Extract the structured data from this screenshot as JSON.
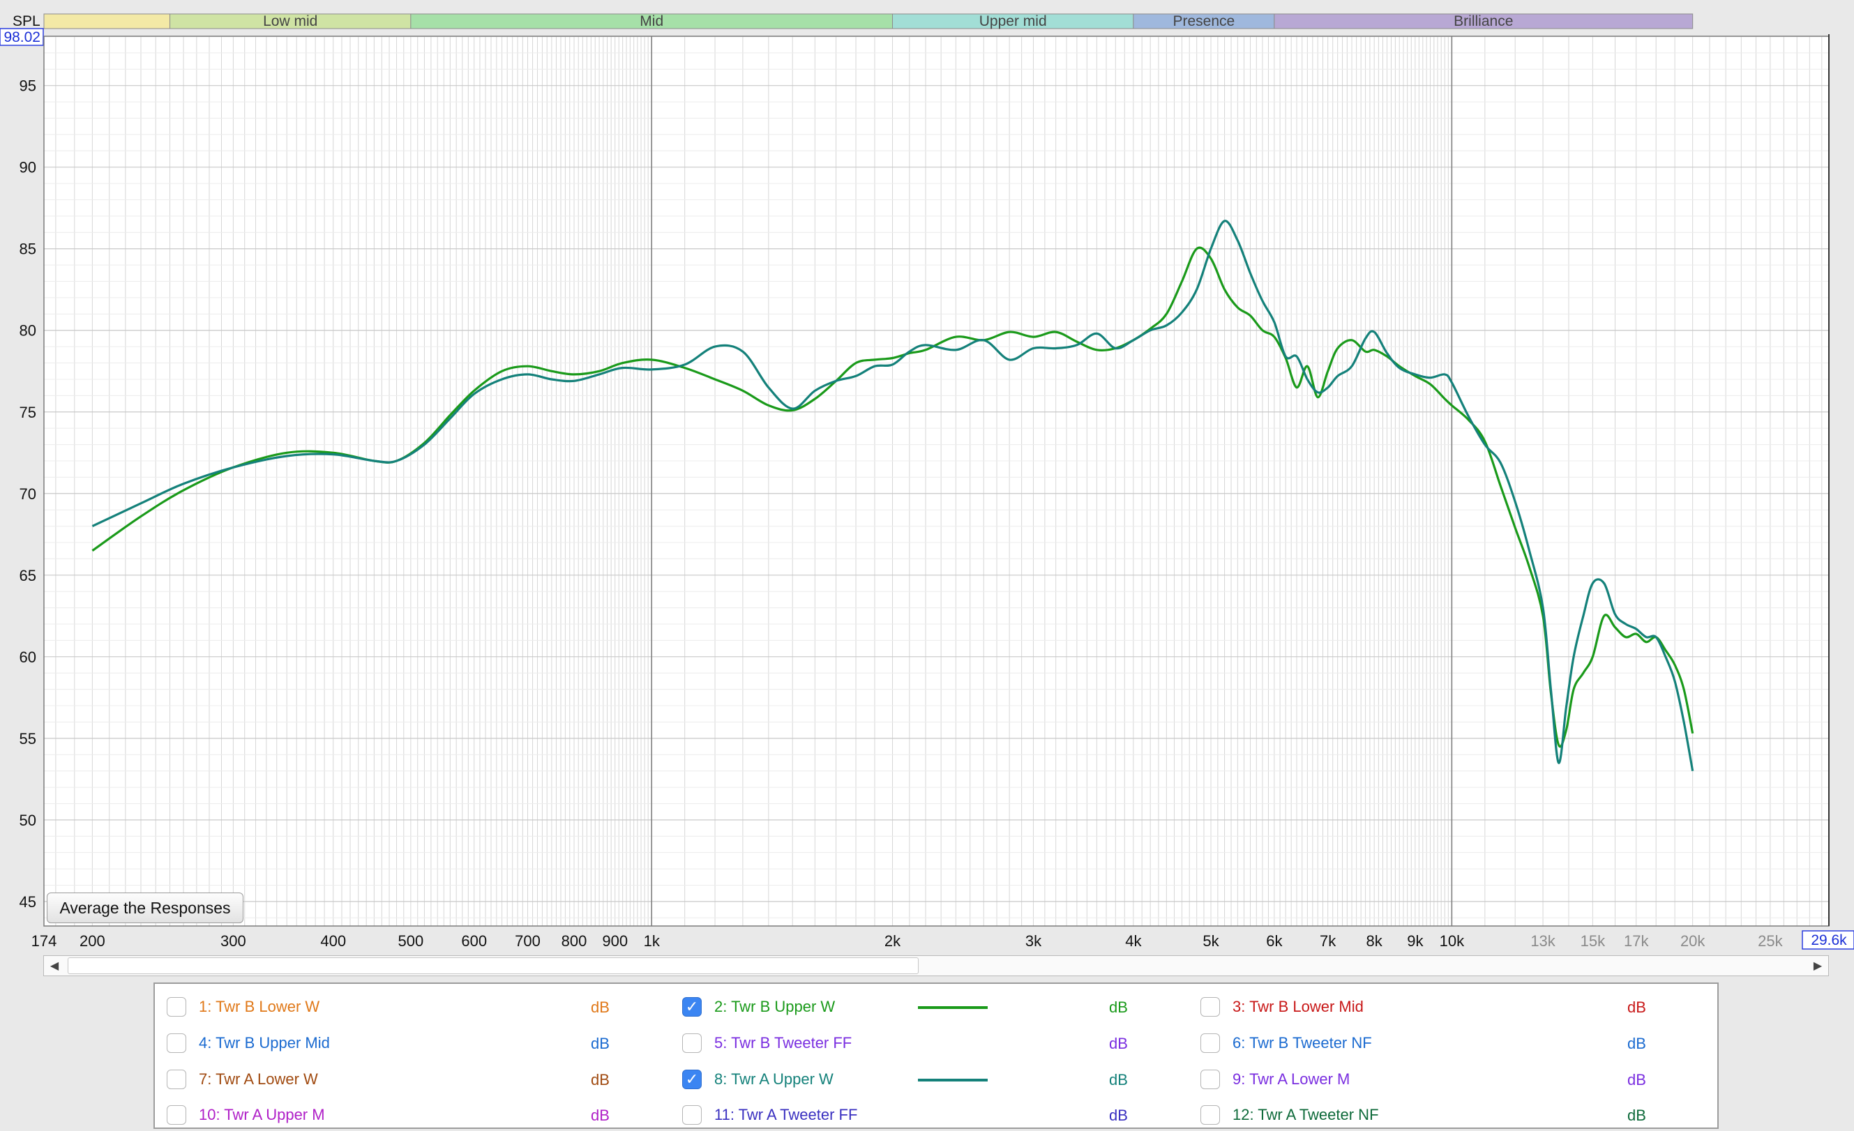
{
  "colors": {
    "plot_bg": "#ffffff",
    "app_bg": "#e9e9e9",
    "grid_major": "#808080",
    "grid_minor": "#d6d6d6",
    "series_green": "#1a9a1a",
    "series_teal": "#14817a",
    "checkbox_on": "#3b85f2"
  },
  "bands": [
    {
      "name": "",
      "start": 135,
      "end": 250,
      "color": "#f3e9a6"
    },
    {
      "name": "Low mid",
      "start": 250,
      "end": 500,
      "color": "#cfe3a4"
    },
    {
      "name": "Mid",
      "start": 500,
      "end": 2000,
      "color": "#a6e0a8"
    },
    {
      "name": "Upper mid",
      "start": 2000,
      "end": 4000,
      "color": "#a2ded6"
    },
    {
      "name": "Presence",
      "start": 4000,
      "end": 6000,
      "color": "#9fb8dd"
    },
    {
      "name": "Brilliance",
      "start": 6000,
      "end": 20000,
      "color": "#b8a8d4"
    }
  ],
  "chart_data": {
    "type": "line",
    "ylabel": "SPL",
    "xscale": "log",
    "xlim": [
      174,
      29600
    ],
    "ylim": [
      43.5,
      98.02
    ],
    "x_min_label": "174",
    "x_max_label": "29.6k",
    "y_max_label": "98.02",
    "yticks": [
      95,
      90,
      85,
      80,
      75,
      70,
      65,
      60,
      55,
      50,
      45
    ],
    "xticks": [
      {
        "v": 200,
        "t": "200"
      },
      {
        "v": 300,
        "t": "300"
      },
      {
        "v": 400,
        "t": "400"
      },
      {
        "v": 500,
        "t": "500"
      },
      {
        "v": 600,
        "t": "600"
      },
      {
        "v": 700,
        "t": "700"
      },
      {
        "v": 800,
        "t": "800"
      },
      {
        "v": 900,
        "t": "900"
      },
      {
        "v": 1000,
        "t": "1k"
      },
      {
        "v": 2000,
        "t": "2k"
      },
      {
        "v": 3000,
        "t": "3k"
      },
      {
        "v": 4000,
        "t": "4k"
      },
      {
        "v": 5000,
        "t": "5k"
      },
      {
        "v": 6000,
        "t": "6k"
      },
      {
        "v": 7000,
        "t": "7k"
      },
      {
        "v": 8000,
        "t": "8k"
      },
      {
        "v": 9000,
        "t": "9k"
      },
      {
        "v": 10000,
        "t": "10k"
      },
      {
        "v": 13000,
        "t": "13k"
      },
      {
        "v": 15000,
        "t": "15k"
      },
      {
        "v": 17000,
        "t": "17k"
      },
      {
        "v": 20000,
        "t": "20k"
      },
      {
        "v": 25000,
        "t": "25k"
      }
    ],
    "grid": true,
    "series": [
      {
        "name": "2: Twr B Upper W",
        "color": "#1a9a1a",
        "x": [
          200,
          230,
          260,
          300,
          350,
          400,
          450,
          480,
          520,
          560,
          600,
          650,
          700,
          750,
          800,
          860,
          920,
          1000,
          1100,
          1200,
          1300,
          1400,
          1500,
          1600,
          1700,
          1800,
          1900,
          2000,
          2100,
          2200,
          2400,
          2600,
          2800,
          3000,
          3200,
          3400,
          3600,
          3800,
          4000,
          4200,
          4400,
          4600,
          4800,
          5000,
          5200,
          5400,
          5600,
          5800,
          6000,
          6200,
          6400,
          6600,
          6800,
          7000,
          7200,
          7500,
          7800,
          8000,
          8300,
          8600,
          9000,
          9400,
          9800,
          10000,
          10500,
          11000,
          11500,
          12000,
          12500,
          13000,
          13300,
          13600,
          13900,
          14200,
          14600,
          15000,
          15500,
          16000,
          16500,
          17000,
          17500,
          18000,
          18500,
          19000,
          19500,
          20000
        ],
        "y": [
          66.5,
          68.6,
          70.2,
          71.6,
          72.5,
          72.5,
          72.0,
          72.0,
          73.1,
          74.8,
          76.3,
          77.5,
          77.8,
          77.5,
          77.3,
          77.5,
          78.0,
          78.2,
          77.7,
          77.0,
          76.3,
          75.4,
          75.1,
          75.8,
          76.9,
          78.0,
          78.2,
          78.3,
          78.6,
          78.8,
          79.6,
          79.4,
          79.9,
          79.6,
          79.9,
          79.3,
          78.8,
          78.9,
          79.4,
          80.1,
          81.0,
          83.0,
          85.0,
          84.4,
          82.5,
          81.4,
          80.9,
          80.0,
          79.6,
          78.3,
          76.5,
          77.8,
          75.9,
          77.5,
          78.9,
          79.4,
          78.7,
          78.8,
          78.4,
          77.8,
          77.2,
          76.7,
          75.8,
          75.4,
          74.5,
          73.2,
          70.5,
          67.9,
          65.5,
          62.5,
          57.8,
          54.6,
          55.5,
          58.0,
          59.0,
          60.0,
          62.5,
          61.8,
          61.2,
          61.4,
          60.9,
          61.2,
          60.4,
          59.5,
          58.0,
          55.3
        ]
      },
      {
        "name": "8: Twr A Upper W",
        "color": "#14817a",
        "x": [
          200,
          230,
          260,
          300,
          350,
          400,
          450,
          480,
          520,
          560,
          600,
          650,
          700,
          750,
          800,
          860,
          920,
          1000,
          1100,
          1200,
          1300,
          1400,
          1500,
          1600,
          1700,
          1800,
          1900,
          2000,
          2100,
          2200,
          2400,
          2600,
          2800,
          3000,
          3200,
          3400,
          3600,
          3800,
          4000,
          4200,
          4400,
          4600,
          4800,
          5000,
          5200,
          5400,
          5600,
          5800,
          6000,
          6200,
          6400,
          6600,
          6800,
          7000,
          7200,
          7500,
          7800,
          8000,
          8300,
          8600,
          9000,
          9400,
          9800,
          10000,
          10500,
          11000,
          11500,
          12000,
          12500,
          13000,
          13300,
          13600,
          13900,
          14200,
          14600,
          15000,
          15500,
          16000,
          16500,
          17000,
          17500,
          18000,
          18500,
          19000,
          19500,
          20000
        ],
        "y": [
          68.0,
          69.4,
          70.6,
          71.6,
          72.3,
          72.4,
          72.0,
          72.0,
          73.0,
          74.6,
          76.1,
          77.0,
          77.3,
          77.0,
          76.9,
          77.3,
          77.7,
          77.6,
          77.9,
          79.0,
          78.7,
          76.5,
          75.2,
          76.3,
          76.9,
          77.2,
          77.8,
          77.9,
          78.7,
          79.1,
          78.8,
          79.4,
          78.2,
          78.9,
          78.9,
          79.1,
          79.8,
          78.9,
          79.4,
          80.0,
          80.3,
          81.1,
          82.5,
          85.0,
          86.7,
          85.5,
          83.5,
          81.8,
          80.5,
          78.4,
          78.4,
          77.0,
          76.2,
          76.5,
          77.2,
          77.8,
          79.5,
          79.9,
          78.6,
          77.7,
          77.3,
          77.1,
          77.3,
          76.8,
          74.7,
          73.0,
          71.9,
          69.5,
          66.5,
          63.0,
          58.0,
          53.5,
          56.9,
          60.0,
          62.5,
          64.5,
          64.5,
          62.6,
          62.0,
          61.7,
          61.2,
          61.2,
          60.0,
          58.5,
          56.0,
          53.0
        ]
      }
    ]
  },
  "plot_button": {
    "label": "Average the Responses"
  },
  "scrollbar": {
    "left_arrow": "◀",
    "right_arrow": "▶"
  },
  "legend": {
    "items": [
      {
        "label": "1: Twr B Lower W",
        "color": "#e07818",
        "unit": "dB",
        "checked": false
      },
      {
        "label": "2: Twr B Upper W",
        "color": "#1a9a1a",
        "unit": "dB",
        "checked": true
      },
      {
        "label": "3: Twr B Lower Mid",
        "color": "#c81818",
        "unit": "dB",
        "checked": false
      },
      {
        "label": "4: Twr B Upper Mid",
        "color": "#1a6ad0",
        "unit": "dB",
        "checked": false
      },
      {
        "label": "5: Twr B Tweeter FF",
        "color": "#7a2ee0",
        "unit": "dB",
        "checked": false
      },
      {
        "label": "6: Twr B Tweeter NF",
        "color": "#1a6ad0",
        "unit": "dB",
        "checked": false
      },
      {
        "label": "7: Twr A Lower W",
        "color": "#a04a10",
        "unit": "dB",
        "checked": false
      },
      {
        "label": "8: Twr A Upper W",
        "color": "#14817a",
        "unit": "dB",
        "checked": true
      },
      {
        "label": "9: Twr A Lower M",
        "color": "#7a2ee0",
        "unit": "dB",
        "checked": false
      },
      {
        "label": "10: Twr A Upper M",
        "color": "#b020c8",
        "unit": "dB",
        "checked": false
      },
      {
        "label": "11: Twr A Tweeter FF",
        "color": "#3a30c0",
        "unit": "dB",
        "checked": false
      },
      {
        "label": "12: Twr A Tweeter NF",
        "color": "#0e6a3a",
        "unit": "dB",
        "checked": false
      }
    ]
  }
}
